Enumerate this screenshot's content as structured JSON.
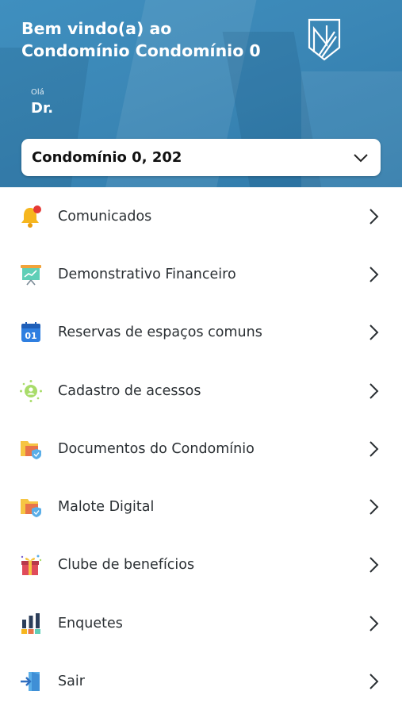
{
  "header": {
    "welcome_line1": "Bem vindo(a) ao",
    "welcome_line2": "Condomínio Condomínio 0",
    "greeting": "Olá",
    "user_name": "Dr.",
    "logo_icon": "brand-logo-icon",
    "background_color": "#3b87b6"
  },
  "unit_selector": {
    "value": "Condomínio 0, 202",
    "icon": "chevron-down-icon"
  },
  "menu": {
    "items": [
      {
        "label": "Comunicados",
        "icon": "bell-notification-icon"
      },
      {
        "label": "Demonstrativo Financeiro",
        "icon": "financial-chart-board-icon"
      },
      {
        "label": "Reservas de espaços comuns",
        "icon": "calendar-icon"
      },
      {
        "label": "Cadastro de acessos",
        "icon": "access-user-icon"
      },
      {
        "label": "Documentos do Condomínio",
        "icon": "folder-shield-icon"
      },
      {
        "label": "Malote Digital",
        "icon": "folder-shield-icon"
      },
      {
        "label": "Clube de benefícios",
        "icon": "gift-box-icon"
      },
      {
        "label": "Enquetes",
        "icon": "poll-bars-icon"
      },
      {
        "label": "Sair",
        "icon": "logout-door-icon"
      }
    ]
  }
}
